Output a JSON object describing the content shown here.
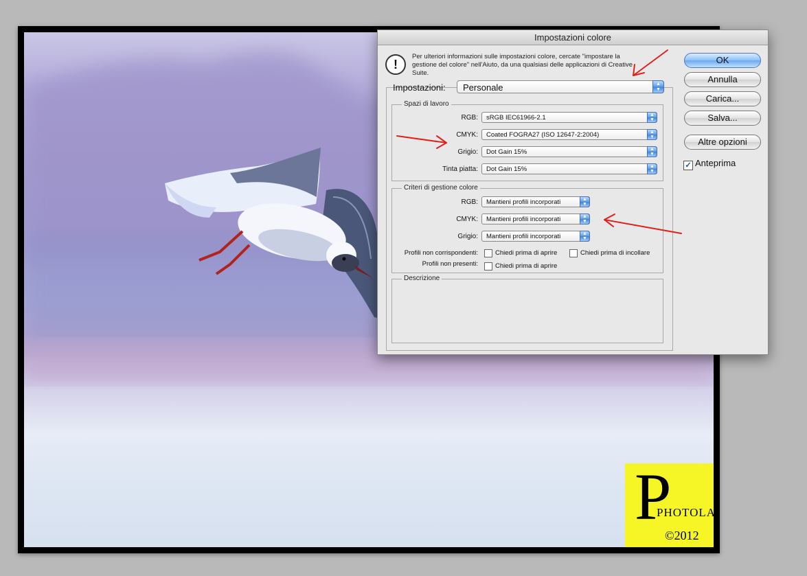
{
  "watermark": {
    "initial": "P",
    "name": "PHOTOLAB",
    "year": "©2012"
  },
  "dialog": {
    "title": "Impostazioni colore",
    "info_text": "Per ulteriori informazioni sulle impostazioni colore, cercate \"impostare la gestione del colore\" nell'Aiuto, da una qualsiasi delle applicazioni di Creative Suite.",
    "info_icon": "!",
    "buttons": {
      "ok": "OK",
      "cancel": "Annulla",
      "load": "Carica...",
      "save": "Salva...",
      "more": "Altre opzioni"
    },
    "preview": {
      "label": "Anteprima",
      "checked": true
    },
    "settings": {
      "label": "Impostazioni:",
      "value": "Personale"
    },
    "working_spaces": {
      "legend": "Spazi di lavoro",
      "rows": [
        {
          "label": "RGB:",
          "value": "sRGB IEC61966-2.1"
        },
        {
          "label": "CMYK:",
          "value": "Coated FOGRA27 (ISO 12647-2:2004)"
        },
        {
          "label": "Grigio:",
          "value": "Dot Gain 15%"
        },
        {
          "label": "Tinta piatta:",
          "value": "Dot Gain 15%"
        }
      ]
    },
    "policies": {
      "legend": "Criteri di gestione colore",
      "rows": [
        {
          "label": "RGB:",
          "value": "Mantieni profili incorporati"
        },
        {
          "label": "CMYK:",
          "value": "Mantieni profili incorporati"
        },
        {
          "label": "Grigio:",
          "value": "Mantieni profili incorporati"
        }
      ],
      "mismatch_label": "Profili non corrispondenti:",
      "ask_open": "Chiedi prima di aprire",
      "ask_paste": "Chiedi prima di incollare",
      "missing_label": "Profili non presenti:",
      "missing_ask_open": "Chiedi prima di aprire"
    },
    "description": {
      "legend": "Descrizione"
    }
  },
  "colors": {
    "annotation": "#e0201a",
    "aqua_blue": "#6aa8ef",
    "watermark_bg": "#f6f627"
  }
}
